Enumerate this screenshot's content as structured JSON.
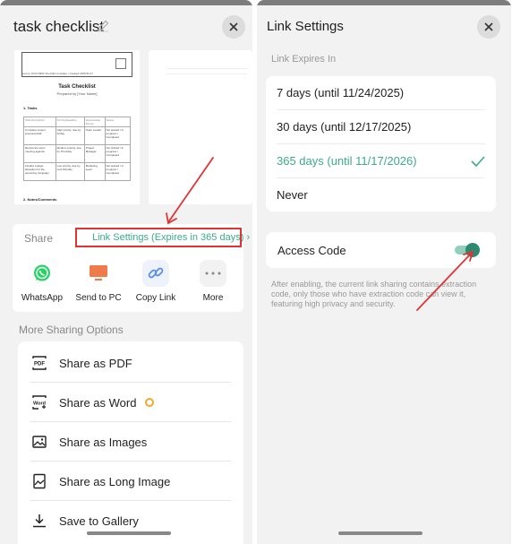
{
  "left_panel": {
    "title": "task checklist",
    "preview": {
      "header_small": "Source: DOCVIEW Checklist template • Created 2025/11/17",
      "title": "Task Checklist",
      "subtitle": "Prepared by [Your Name]",
      "section1": "1. Tasks",
      "columns": [
        "Task Description",
        "Priority/Deadline",
        "Responsible Person",
        "Status"
      ],
      "rows": [
        [
          "Complete project proposal draft",
          "High priority, due by Friday",
          "Team Leader",
          "Not started / In progress / Completed"
        ],
        [
          "Review the team meeting agenda",
          "Medium priority, due by Thursday",
          "Project Manager",
          "Not started / In progress / Completed"
        ],
        [
          "Finalize budget allocation for the upcoming campaign",
          "Low priority, due by next Monday",
          "Marketing Lead",
          "Not started / In progress / Completed"
        ]
      ],
      "section2": "2. Notes/Comments"
    },
    "share_label": "Share",
    "link_settings": "Link Settings (Expires in 365 days)",
    "link_settings_chevron": "›",
    "apps": [
      {
        "label": "WhatsApp",
        "icon": "whatsapp-icon"
      },
      {
        "label": "Send to PC",
        "icon": "monitor-icon"
      },
      {
        "label": "Copy Link",
        "icon": "link-icon"
      },
      {
        "label": "More",
        "icon": "more-icon"
      }
    ],
    "more_sharing_title": "More Sharing Options",
    "options": [
      {
        "label": "Share as PDF",
        "icon": "pdf-icon"
      },
      {
        "label": "Share as Word",
        "icon": "word-icon"
      },
      {
        "label": "Share as Images",
        "icon": "image-icon"
      },
      {
        "label": "Share as Long Image",
        "icon": "long-image-icon"
      },
      {
        "label": "Save to Gallery",
        "icon": "download-icon"
      }
    ],
    "pdf_icon_text": "PDF",
    "word_icon_text": "Word"
  },
  "right_panel": {
    "title": "Link Settings",
    "expires_label": "Link Expires In",
    "expiry_options": [
      {
        "label": "7 days (until 11/24/2025)",
        "selected": false
      },
      {
        "label": "30 days (until 12/17/2025)",
        "selected": false
      },
      {
        "label": "365 days (until 11/17/2026)",
        "selected": true
      },
      {
        "label": "Never",
        "selected": false
      }
    ],
    "access_code_label": "Access Code",
    "access_code_enabled": true,
    "access_note": "After enabling, the current link sharing contains extraction code, only those who have extraction code can view it, featuring high privacy and security."
  },
  "colors": {
    "accent": "#3daa8a",
    "annotation_red": "#e03434",
    "whatsapp": "#25d366",
    "send_to_pc": "#f07b4a",
    "copy_link": "#5b8def"
  }
}
